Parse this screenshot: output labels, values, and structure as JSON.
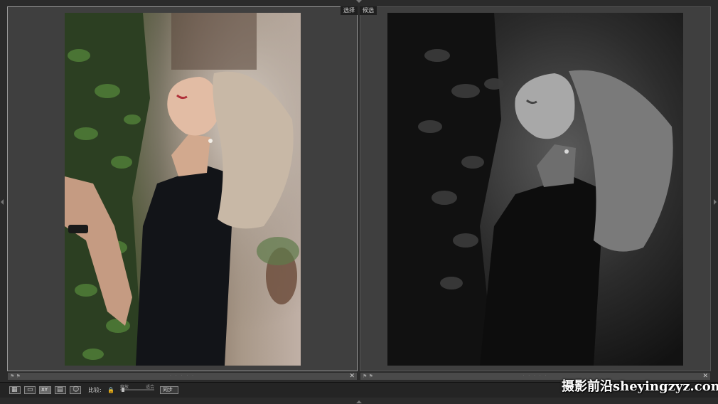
{
  "compare": {
    "select_tag": "选择",
    "candidate_tag": "候选",
    "footer_stars": "· · · · ·",
    "footer_flags": "⚑ ⚑",
    "close_glyph": "✕"
  },
  "toolbar": {
    "compare_label": "比较:",
    "zoom_label": "缩放",
    "fit_label": "适合",
    "sync_label": "同步",
    "lock_glyph": "🔒",
    "grid_glyph": "▦",
    "loupe_glyph": "▭",
    "xy_label": "XY",
    "survey_glyph": "▤",
    "people_glyph": "☺"
  },
  "watermark": {
    "text": "摄影前沿sheyingzyz.com"
  },
  "colors": {
    "pane_bg": "#3f3f3f",
    "toolbar_bg": "#242424",
    "app_bg": "#2b2b2b"
  }
}
